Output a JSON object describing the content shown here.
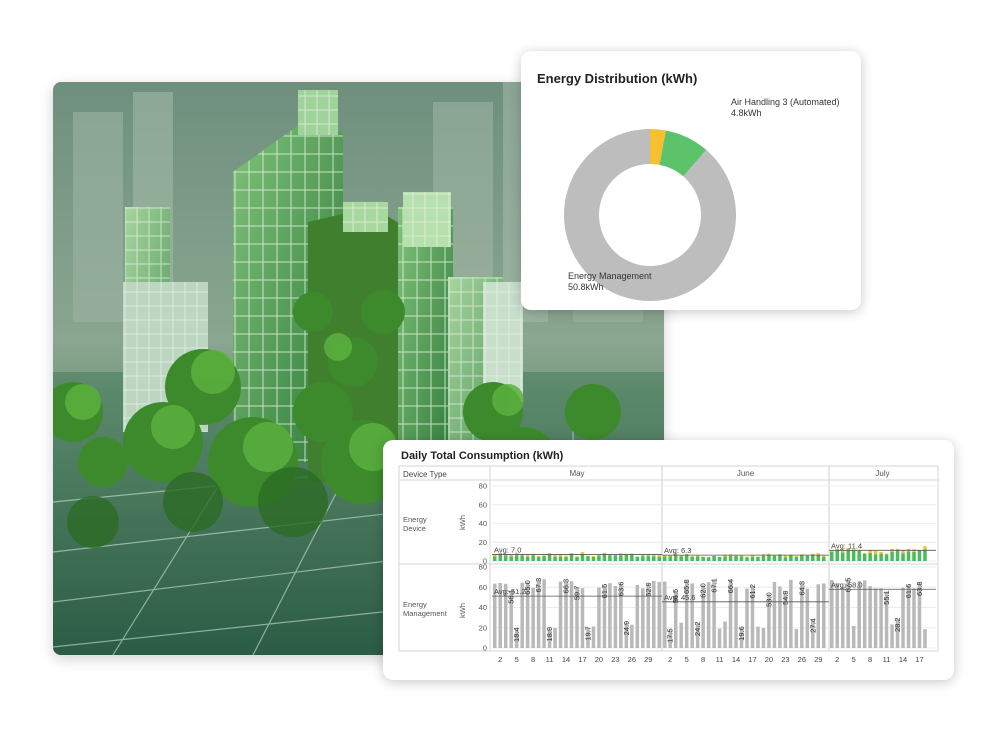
{
  "distribution": {
    "title": "Energy Distribution (kWh)",
    "segments": [
      {
        "name": "Energy Management",
        "value_label": "50.8kWh",
        "value": 50.8,
        "color": "#bdbdbd"
      },
      {
        "name": "Air Handling 3 (Automated)",
        "value_label": "4.8kWh",
        "value": 4.8,
        "color": "#5cc36a"
      },
      {
        "name": "",
        "value_label": "",
        "value": 1.7,
        "color": "#f5c130"
      }
    ]
  },
  "daily": {
    "title": "Daily Total Consumption (kWh)",
    "row_header": "Device Type",
    "months": [
      "May",
      "June",
      "July"
    ],
    "rows": [
      {
        "label_line1": "Energy",
        "label_line2": "Device",
        "unit": "kWh",
        "avg_label": "Avg: 7.0"
      },
      {
        "label_line1": "Energy",
        "label_line2": "Management",
        "unit": "kWh",
        "avg_label": "Avg: 51.2"
      }
    ],
    "month_avgs": [
      {
        "device": "Avg: 7.0",
        "management": "Avg: 51.2"
      },
      {
        "device": "Avg: 6.3",
        "management": "Avg: 45.6"
      },
      {
        "device": "Avg: 11.4",
        "management": "Avg: 58.0"
      }
    ],
    "y_ticks": [
      "0",
      "20",
      "40",
      "60",
      "80"
    ],
    "x_ticks": [
      "2",
      "5",
      "8",
      "11",
      "14",
      "17",
      "20",
      "23",
      "26",
      "29",
      "2",
      "5",
      "8",
      "11",
      "14",
      "17",
      "20",
      "23",
      "26",
      "29",
      "2",
      "5",
      "8",
      "11",
      "14",
      "17"
    ],
    "colors": {
      "bar_gray": "#b9b9b9",
      "green": "#4cbb5a",
      "yellow": "#f2c12e"
    }
  },
  "chart_data": [
    {
      "type": "pie",
      "title": "Energy Distribution (kWh)",
      "labels": [
        "Energy Management",
        "Air Handling 3 (Automated)",
        ""
      ],
      "values": [
        50.8,
        4.8,
        1.7
      ]
    },
    {
      "type": "bar",
      "title": "Daily Total Consumption (kWh)",
      "ylim": [
        0,
        80
      ],
      "ylabel": "kWh",
      "series": [
        {
          "name": "Energy Management",
          "months": [
            {
              "month": "May",
              "avg": 51.2,
              "labels": [
                {
                  "day": 4,
                  "value": 56.1
                },
                {
                  "day": 5,
                  "value": 18.4
                },
                {
                  "day": 7,
                  "value": 65.0
                },
                {
                  "day": 9,
                  "value": 67.3
                },
                {
                  "day": 11,
                  "value": 18.9
                },
                {
                  "day": 14,
                  "value": 66.3
                },
                {
                  "day": 16,
                  "value": 59.7
                },
                {
                  "day": 18,
                  "value": 19.7
                },
                {
                  "day": 21,
                  "value": 61.5
                },
                {
                  "day": 24,
                  "value": 63.6
                },
                {
                  "day": 25,
                  "value": 24.9
                },
                {
                  "day": 29,
                  "value": 62.9
                }
              ]
            },
            {
              "month": "June",
              "avg": 45.6,
              "labels": [
                {
                  "day": 2,
                  "value": 17.5
                },
                {
                  "day": 3,
                  "value": 56.5
                },
                {
                  "day": 5,
                  "value": 65.8
                },
                {
                  "day": 7,
                  "value": 24.2
                },
                {
                  "day": 8,
                  "value": 62.0
                },
                {
                  "day": 10,
                  "value": 67.1
                },
                {
                  "day": 13,
                  "value": 66.4
                },
                {
                  "day": 15,
                  "value": 19.6
                },
                {
                  "day": 17,
                  "value": 61.2
                },
                {
                  "day": 20,
                  "value": 53.0
                },
                {
                  "day": 23,
                  "value": 54.9
                },
                {
                  "day": 26,
                  "value": 64.3
                },
                {
                  "day": 28,
                  "value": 27.4
                }
              ]
            },
            {
              "month": "July",
              "avg": 58.0,
              "labels": [
                {
                  "day": 4,
                  "value": 67.5
                },
                {
                  "day": 11,
                  "value": 55.1
                },
                {
                  "day": 13,
                  "value": 28.2
                },
                {
                  "day": 15,
                  "value": 61.6
                },
                {
                  "day": 17,
                  "value": 63.8
                }
              ]
            }
          ]
        },
        {
          "name": "Energy Device",
          "months": [
            {
              "month": "May",
              "avg": 7.0
            },
            {
              "month": "June",
              "avg": 6.3
            },
            {
              "month": "July",
              "avg": 11.4
            }
          ]
        }
      ]
    }
  ]
}
